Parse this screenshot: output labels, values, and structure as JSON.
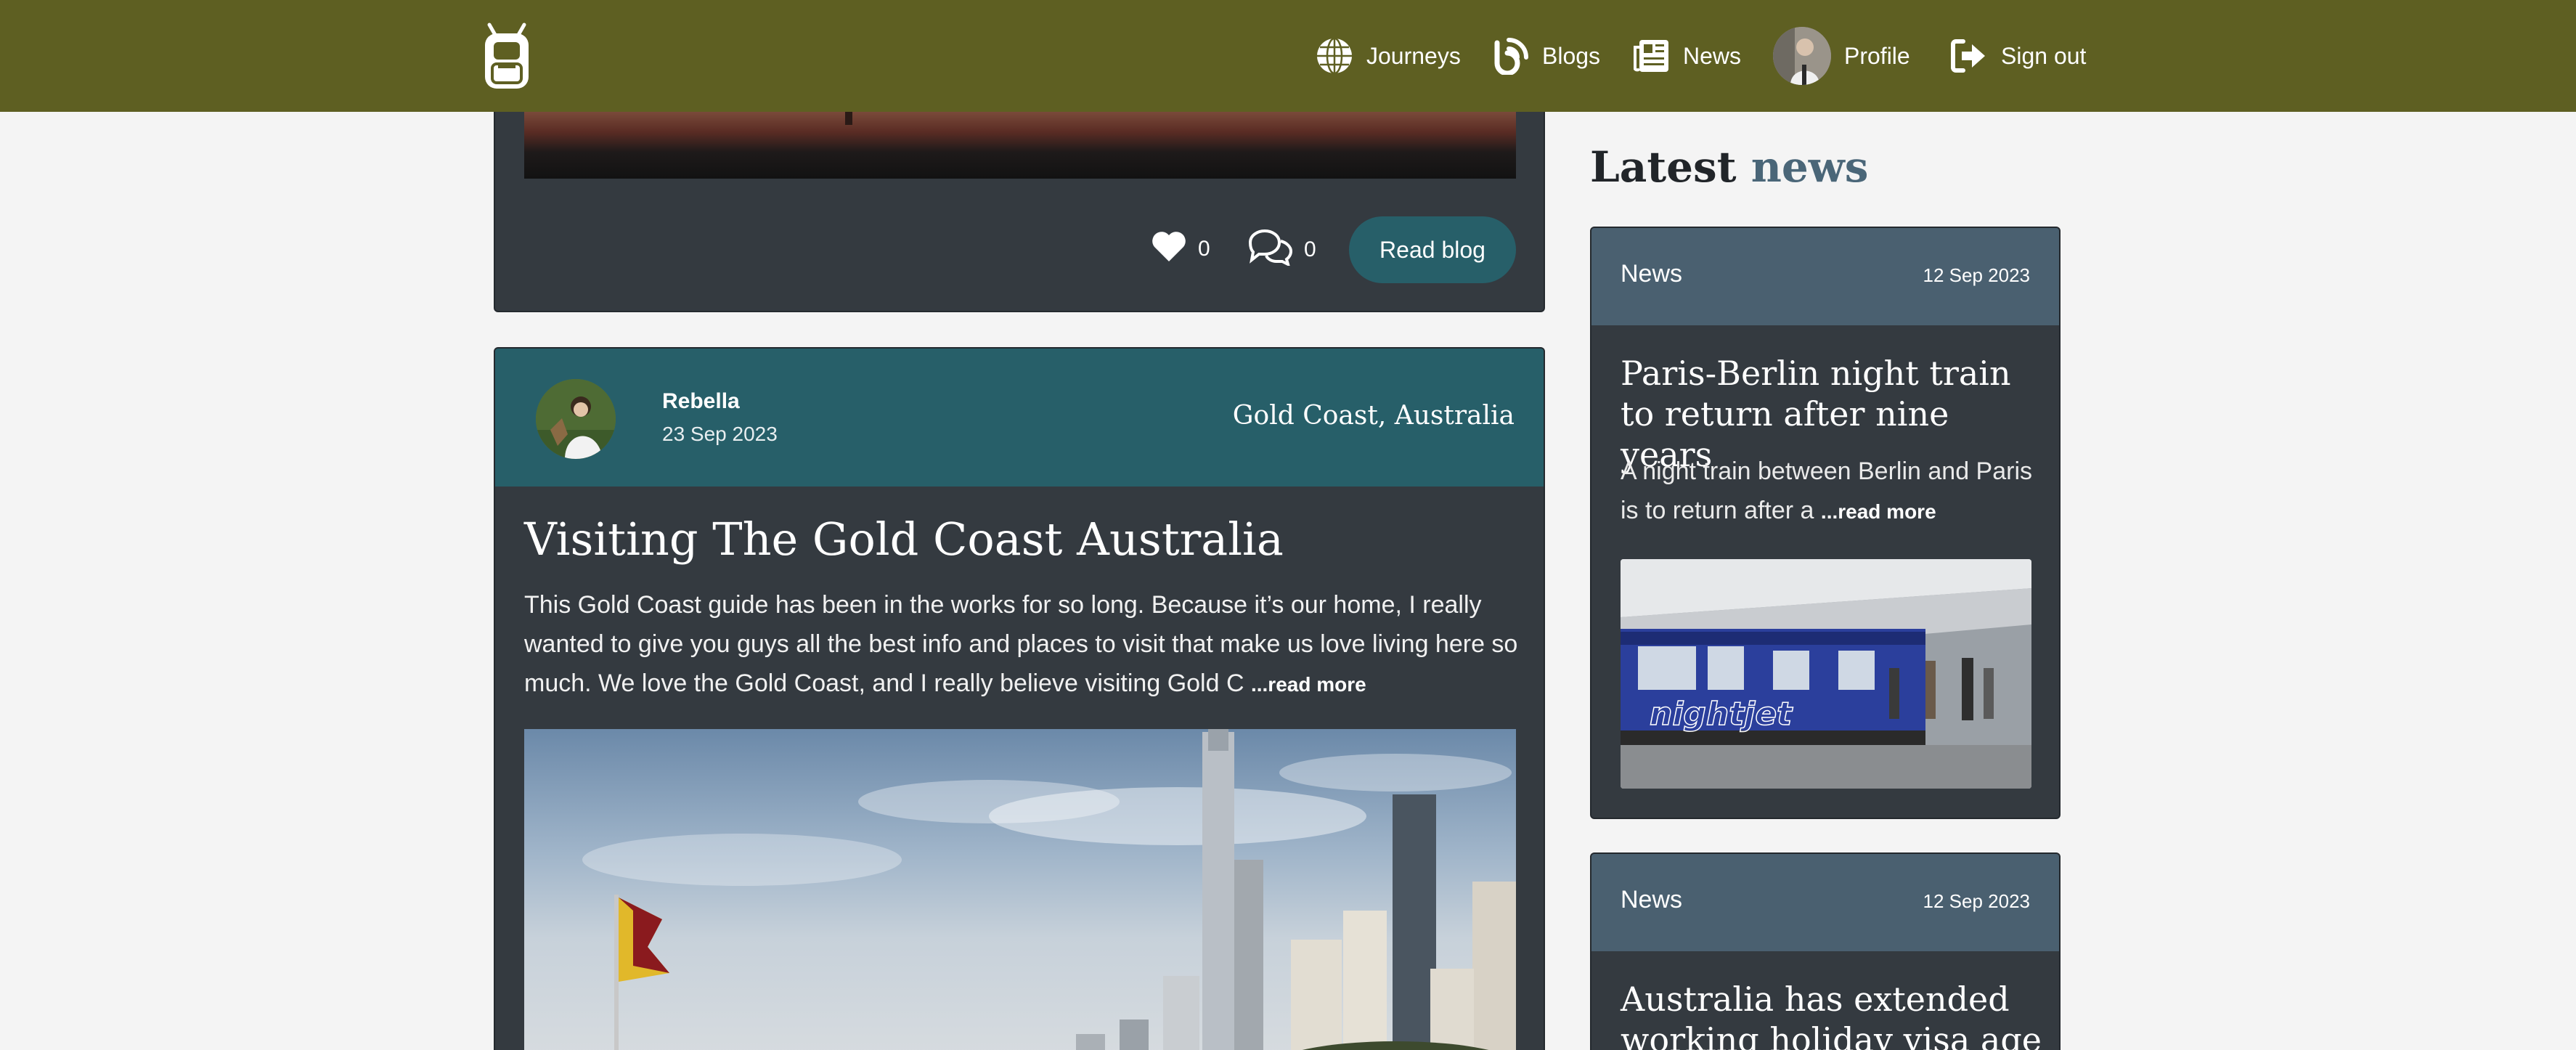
{
  "colors": {
    "navbar": "#5e5f22",
    "card": "#343a40",
    "card_header_teal": "#275f69",
    "news_header": "#4a6070",
    "page_bg": "#f4f4f4",
    "accent_blue": "#4a6678"
  },
  "nav": {
    "logo_icon": "backpack-icon",
    "items": [
      {
        "label": "Journeys",
        "icon": "globe-icon"
      },
      {
        "label": "Blogs",
        "icon": "blog-icon"
      },
      {
        "label": "News",
        "icon": "newspaper-icon"
      },
      {
        "label": "Profile",
        "icon": "avatar"
      },
      {
        "label": "Sign out",
        "icon": "sign-out-icon"
      }
    ]
  },
  "blog_prev": {
    "likes": "0",
    "comments": "0",
    "read_label": "Read blog"
  },
  "blog": {
    "author": "Rebella",
    "date": "23 Sep 2023",
    "location": "Gold Coast, Australia",
    "title": "Visiting The Gold Coast Australia",
    "excerpt": "This Gold Coast guide has been in the works for so long. Because it’s our home, I really wanted to give you guys all the best info and places to visit that make us love living here so much. We love the Gold Coast, and I really believe visiting Gold C",
    "read_more": "...read more"
  },
  "latest": {
    "heading_word1": "Latest",
    "heading_word2": "news",
    "news": [
      {
        "label": "News",
        "date": "12 Sep 2023",
        "title": "Paris-Berlin night train to return after nine years",
        "excerpt": "A night train between Berlin and Paris is to return after a",
        "read_more": "...read more",
        "image_text": "nightjet"
      },
      {
        "label": "News",
        "date": "12 Sep 2023",
        "title": "Australia has extended working holiday visa age"
      }
    ]
  }
}
